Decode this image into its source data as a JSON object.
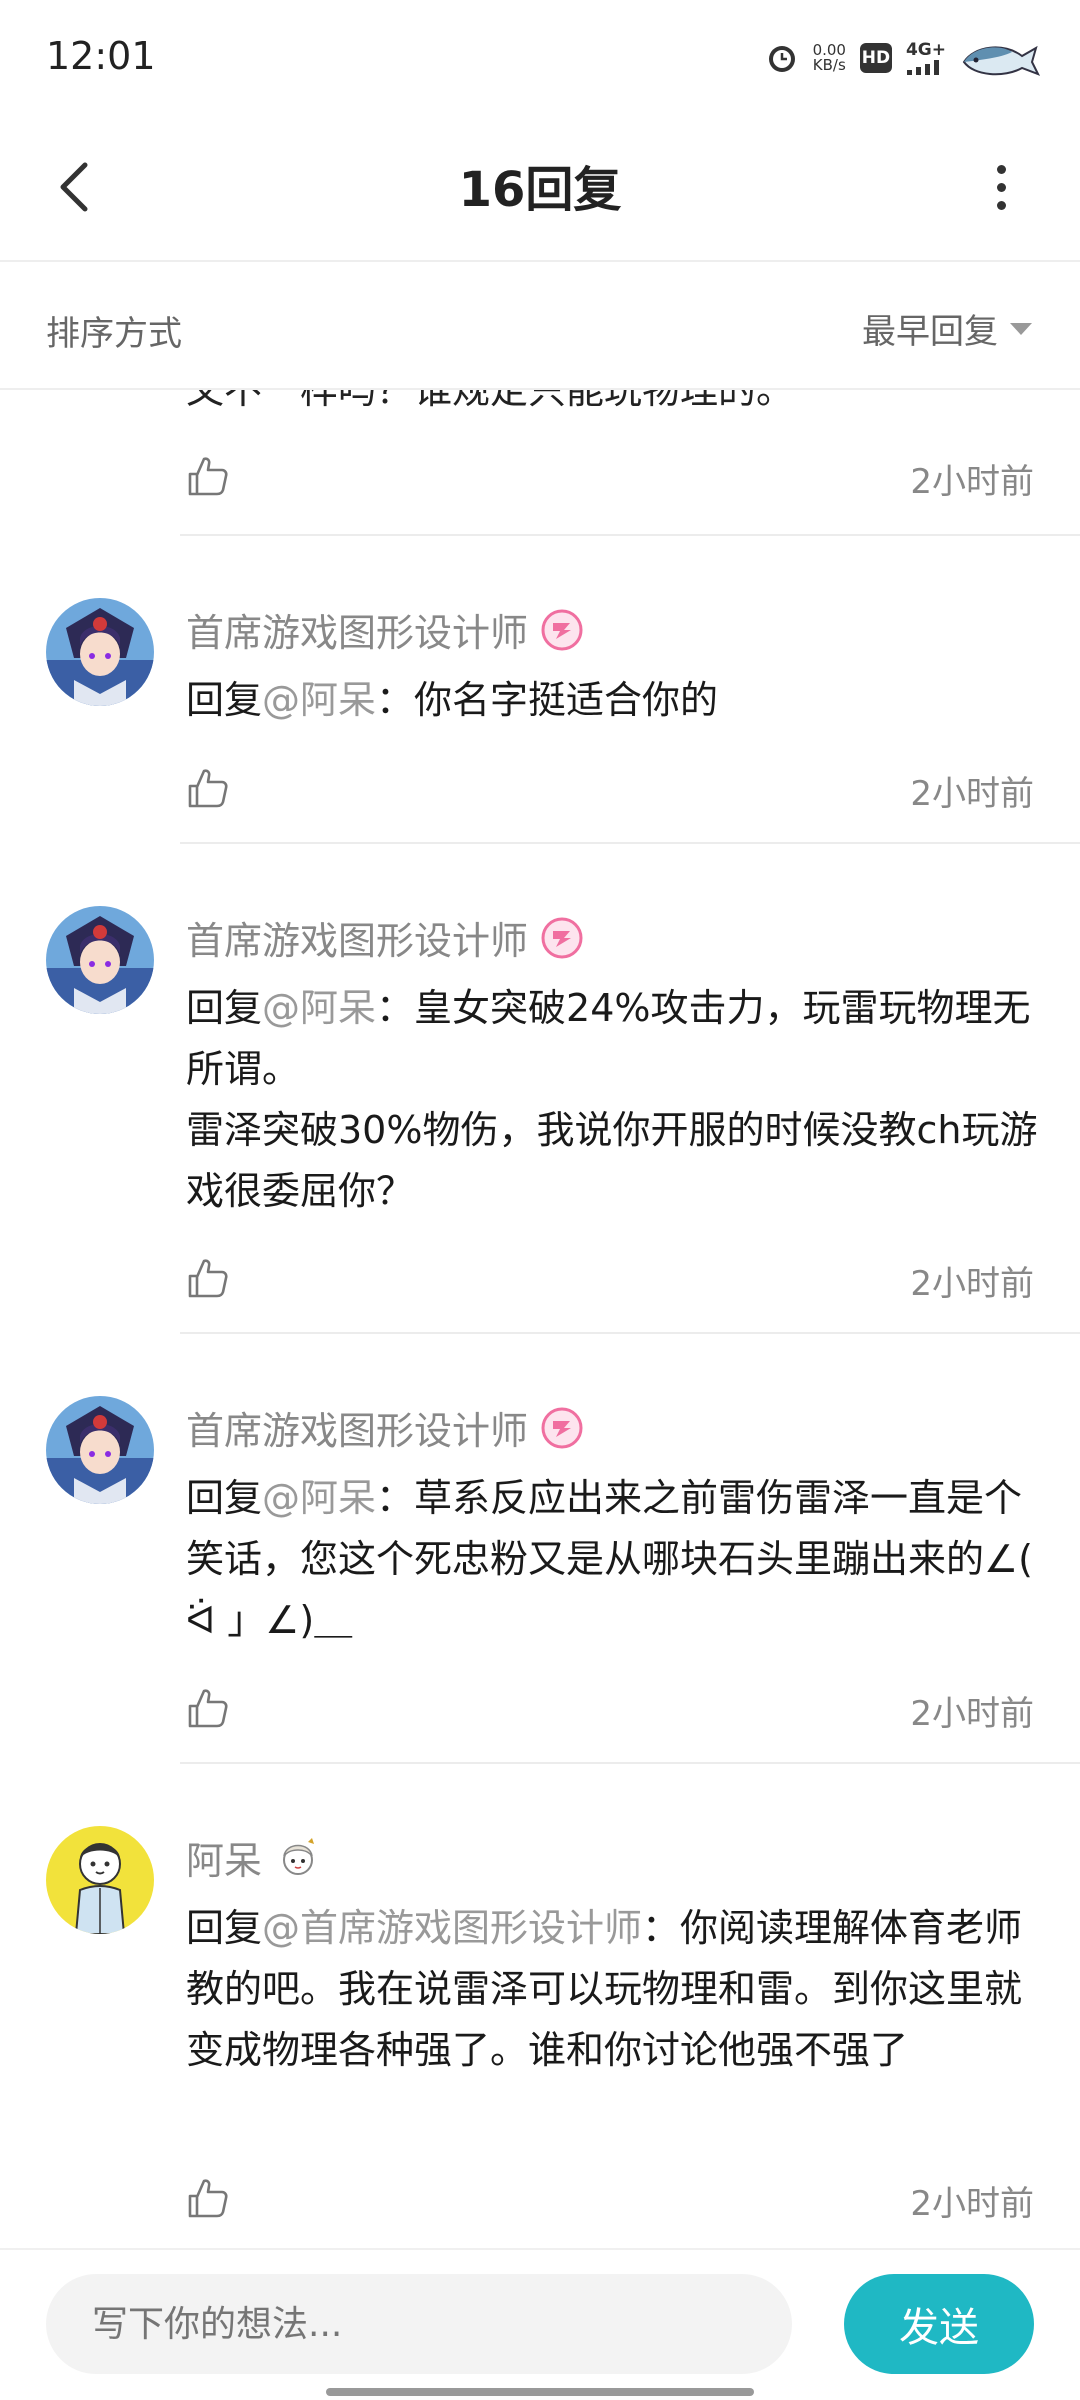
{
  "status_bar": {
    "time": "12:01",
    "net_speed_value": "0.00",
    "net_speed_unit": "KB/s",
    "hd": "HD",
    "network": "4G+"
  },
  "header": {
    "title": "16回复"
  },
  "sort": {
    "label": "排序方式",
    "selected": "最早回复"
  },
  "previous_comment": {
    "partial_text": "又不一样吗？谁规定只能玩物理的。",
    "time": "2小时前"
  },
  "comments": [
    {
      "username": "首席游戏图形设计师",
      "reply_prefix": "回复",
      "mention": "@阿呆",
      "text": "：你名字挺适合你的",
      "time": "2小时前"
    },
    {
      "username": "首席游戏图形设计师",
      "reply_prefix": "回复",
      "mention": "@阿呆",
      "text": "：皇女突破24%攻击力，玩雷玩物理无所谓。",
      "text2": "雷泽突破30%物伤，我说你开服的时候没教ch玩游戏很委屈你？",
      "time": "2小时前"
    },
    {
      "username": "首席游戏图形设计师",
      "reply_prefix": "回复",
      "mention": "@阿呆",
      "text": "：草系反应出来之前雷伤雷泽一直是个笑话，您这个死忠粉又是从哪块石头里蹦出来的∠( ᐛ 」∠)＿",
      "time": "2小时前"
    },
    {
      "username": "阿呆",
      "reply_prefix": "回复",
      "mention": "@首席游戏图形设计师",
      "text": "：你阅读理解体育老师教的吧。我在说雷泽可以玩物理和雷。到你这里就变成物理各种强了。谁和你讨论他强不强了",
      "time": "2小时前"
    }
  ],
  "input": {
    "placeholder": "写下你的想法...",
    "send_label": "发送"
  },
  "colors": {
    "accent": "#1fb8c4",
    "mention": "#999999",
    "badge_pink": "#f06fa0"
  }
}
